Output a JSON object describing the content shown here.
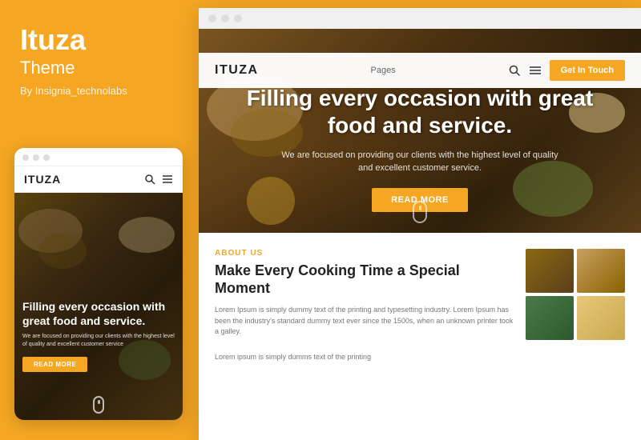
{
  "left": {
    "brand_name": "Ituza",
    "brand_subtitle": "Theme",
    "brand_author": "By Insignia_technolabs"
  },
  "mobile": {
    "logo": "ITUZA",
    "hero_title": "Filling every occasion with great food and service.",
    "hero_desc": "We are focused on providing our clients with the highest level of quality and excellent customer service",
    "read_more_btn": "READ MORE"
  },
  "desktop": {
    "dots_bar": "window-controls",
    "nav": {
      "logo": "ITUZA",
      "pages_label": "Pages",
      "get_in_touch": "Get In Touch"
    },
    "hero": {
      "title": "Filling every occasion with great food and service.",
      "description": "We are focused on providing our clients with the highest level of quality and excellent customer service.",
      "cta_btn": "READ MORE"
    },
    "about": {
      "section_label": "ABOUT US",
      "title": "Make Every Cooking Time a Special Moment",
      "body1": "Lorem Ipsum is simply dummy text of the printing and typesetting industry. Lorem Ipsum has been the industry's standard dummy text ever since the 1500s, when an unknown printer took a galley.",
      "body2": "Lorem ipsum is simply dumms text of the printing"
    }
  }
}
